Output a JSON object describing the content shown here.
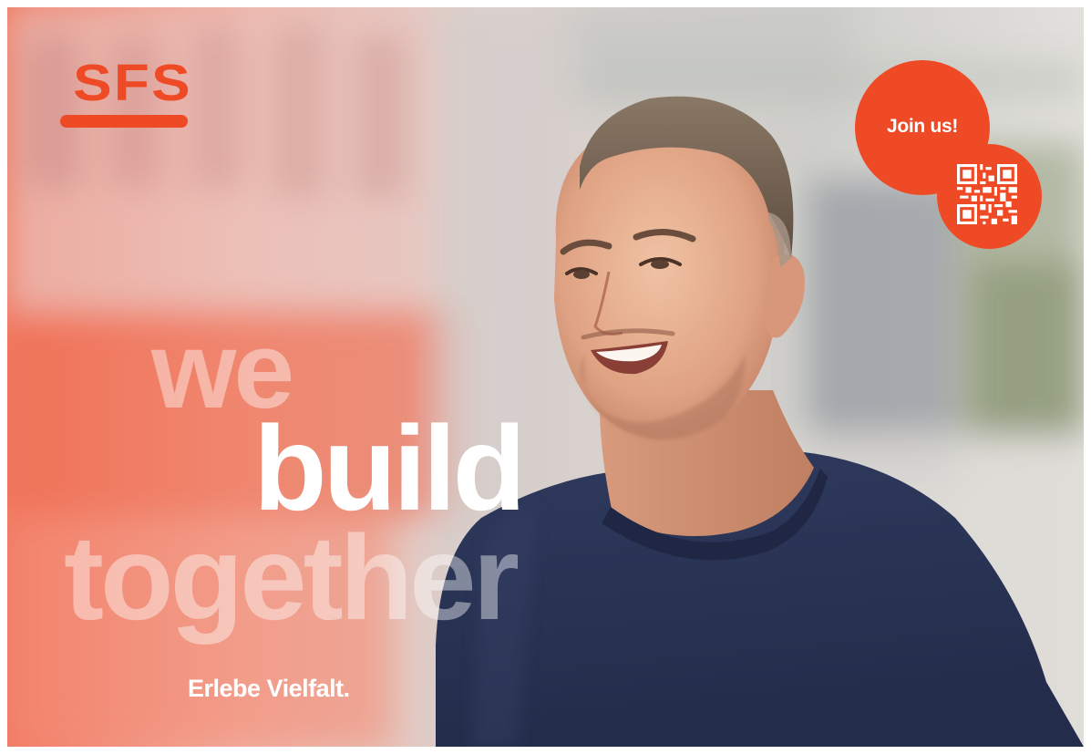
{
  "brand": {
    "logo_text": "SFS",
    "accent_color": "#ee4a26"
  },
  "headline": {
    "line1": "we",
    "line2": "build",
    "line3": "together"
  },
  "tagline": "Erlebe Vielfalt.",
  "badge": {
    "label": "Join us!",
    "qr_icon": "qr-code-icon"
  },
  "photo": {
    "subject_icon": "smiling-man-portrait"
  }
}
